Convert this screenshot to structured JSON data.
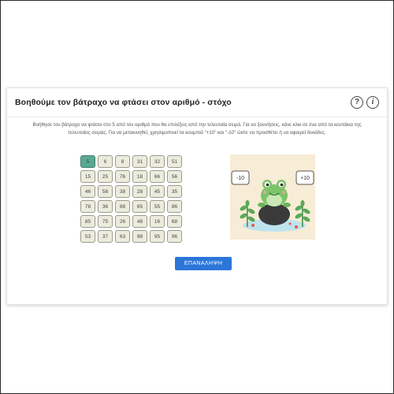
{
  "header": {
    "title": "Βοηθούμε τον βάτραχο να φτάσει στον αριθμό - στόχο",
    "help_icon": "question-circle-icon",
    "info_icon": "info-circle-icon"
  },
  "instructions": "Βοήθησε τον βάτραχο να φτάσει στο 5 από τον αριθμό που θα επιλέξεις από την τελευταία σειρά. Για να ξεκινήσεις, κάνε κλικ σε ένα από τα κουτάκια της τελευταίας σειράς. Για να μετακινηθεί, χρησιμοποιεί τα κουμπιά \"+10\" και \"-10\" ώστε να προσθέτει ή να αφαιρεί δεκάδες.",
  "grid": {
    "rows": [
      [
        "5",
        "6",
        "8",
        "31",
        "32",
        "51"
      ],
      [
        "15",
        "25",
        "76",
        "18",
        "66",
        "56"
      ],
      [
        "46",
        "58",
        "38",
        "28",
        "45",
        "35"
      ],
      [
        "78",
        "36",
        "88",
        "65",
        "55",
        "86"
      ],
      [
        "85",
        "75",
        "26",
        "48",
        "16",
        "68"
      ],
      [
        "53",
        "37",
        "63",
        "98",
        "95",
        "96"
      ]
    ],
    "active_value": "5"
  },
  "scene": {
    "minus_label": "-10",
    "plus_label": "+10",
    "colors": {
      "background": "#f7ecd5",
      "frog": "#7cc36a",
      "rock": "#3a3a3a",
      "water": "#bfe3ee"
    }
  },
  "restart_button": {
    "label": "ΕΠΑΝΑΛΗΨΗ"
  },
  "colors": {
    "accent": "#2c76d9",
    "active_cell": "#5aa892",
    "cell": "#ececde"
  }
}
